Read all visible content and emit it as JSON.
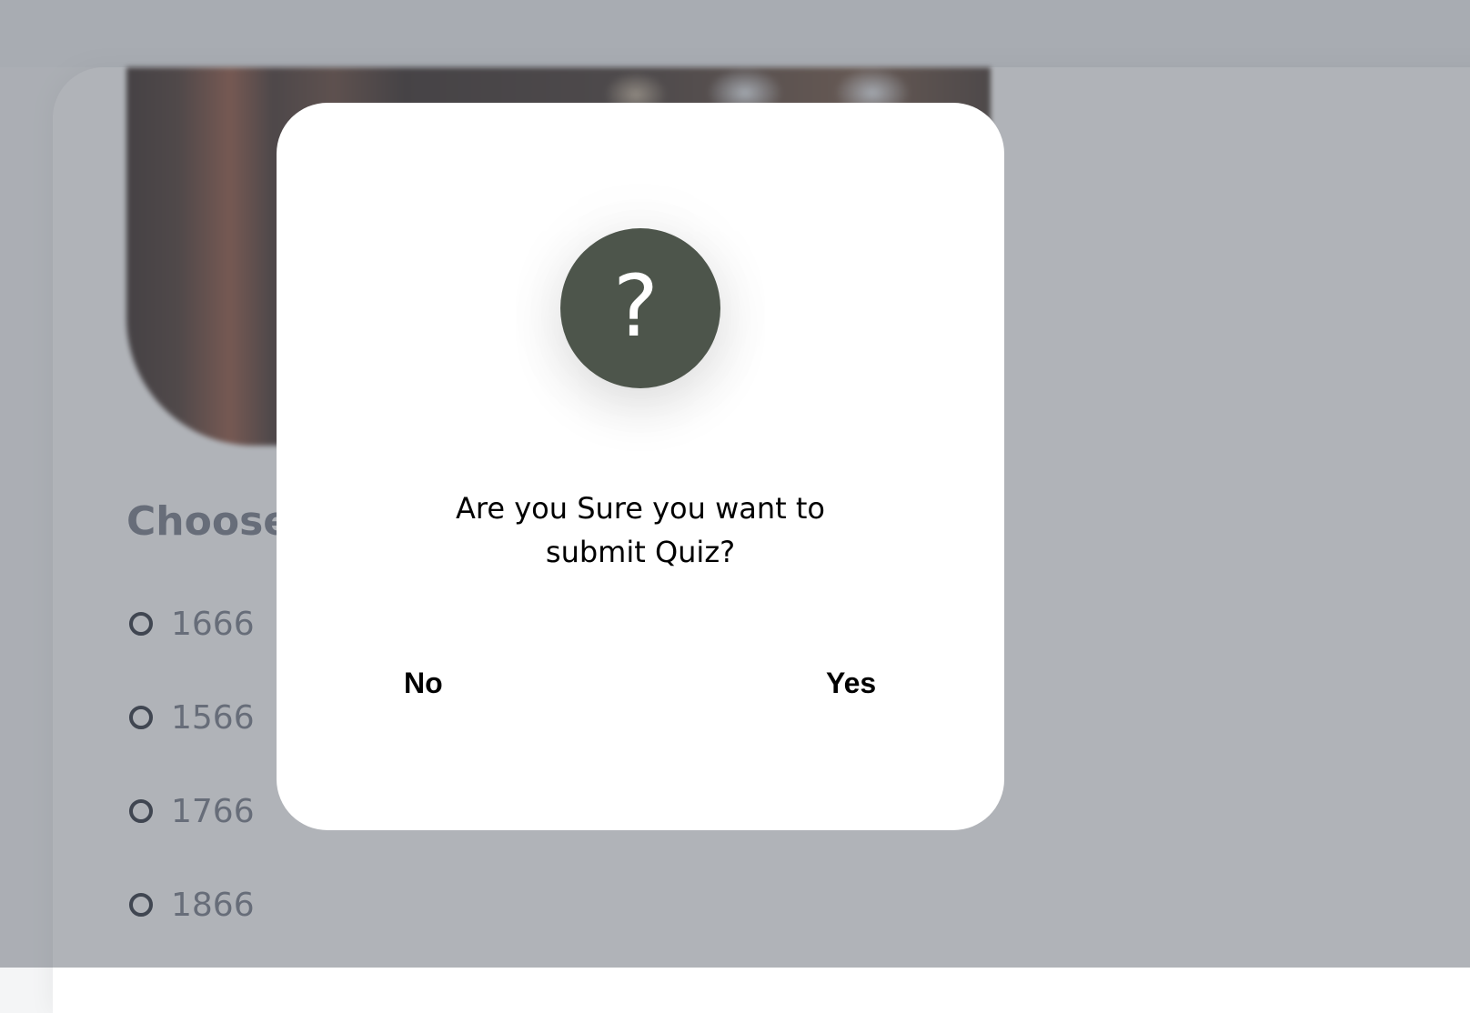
{
  "quiz": {
    "question_partial": "Choose",
    "options": [
      {
        "label": "1666"
      },
      {
        "label": "1566"
      },
      {
        "label": "1766"
      },
      {
        "label": "1866"
      }
    ]
  },
  "dialog": {
    "icon": "question-mark-icon",
    "icon_glyph": "?",
    "icon_color": "#4d554b",
    "message": "Are you Sure you want to submit Quiz?",
    "no_label": "No",
    "yes_label": "Yes"
  }
}
